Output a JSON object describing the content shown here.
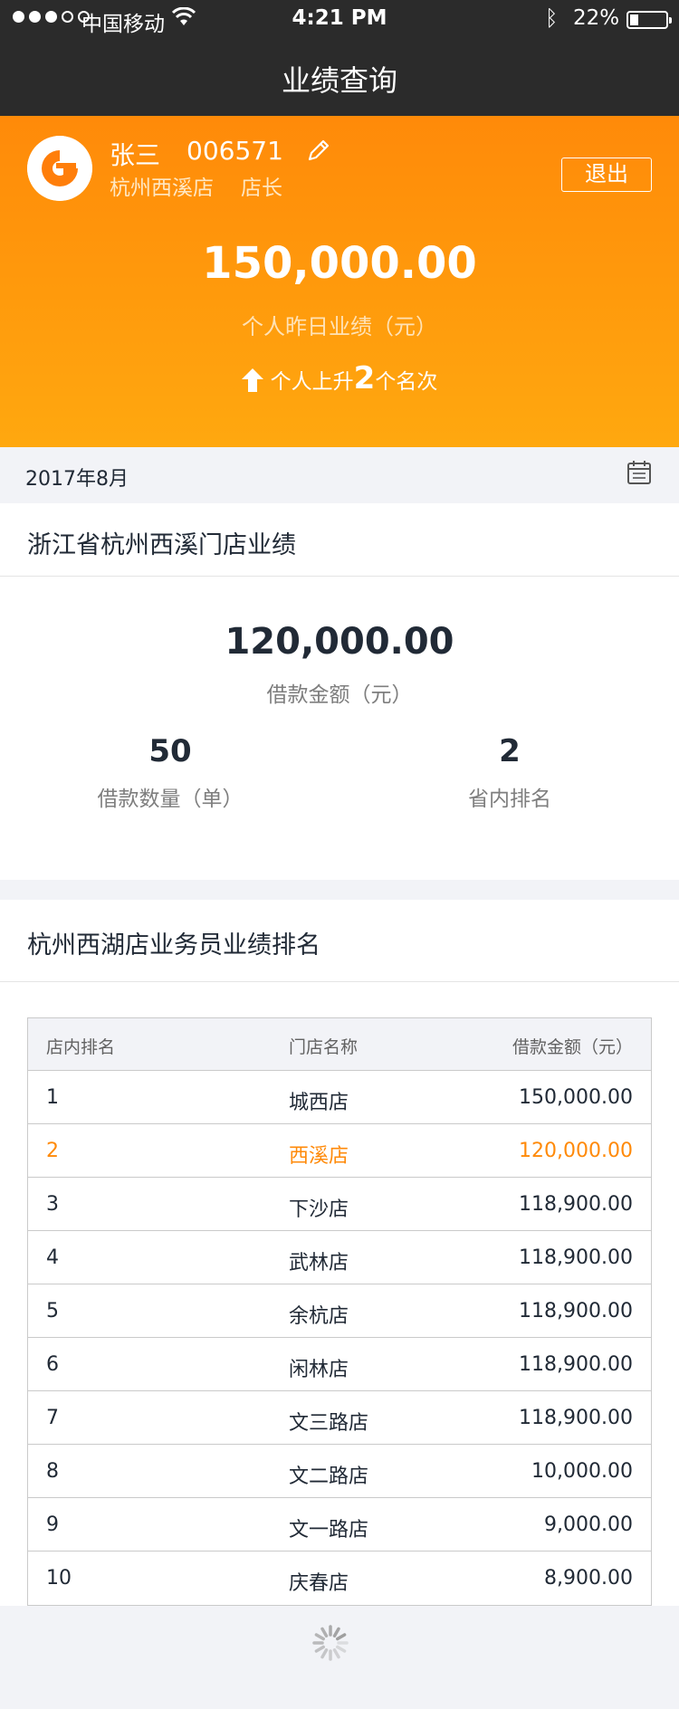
{
  "status_bar": {
    "carrier": "中国移动",
    "time": "4:21 PM",
    "battery_percent": "22%",
    "battery_level": 0.22
  },
  "nav": {
    "title": "业绩查询"
  },
  "profile": {
    "name": "张三",
    "employee_id": "006571",
    "store": "杭州西溪店",
    "role": "店长",
    "logout_label": "退出"
  },
  "summary": {
    "amount": "150,000.00",
    "amount_label": "个人昨日业绩（元）",
    "rank_prefix": "个人上升",
    "rank_change": "2",
    "rank_suffix": "个名次"
  },
  "date_bar": {
    "month": "2017年8月",
    "icon": "calendar-icon"
  },
  "store_panel": {
    "title": "浙江省杭州西溪门店业绩",
    "loan_amount": "120,000.00",
    "loan_amount_label": "借款金额（元）",
    "loan_count": "50",
    "loan_count_label": "借款数量（单）",
    "province_rank": "2",
    "province_rank_label": "省内排名"
  },
  "ranking": {
    "title": "杭州西湖店业务员业绩排名",
    "headers": [
      "店内排名",
      "门店名称",
      "借款金额（元）"
    ],
    "rows": [
      {
        "rank": "1",
        "store": "城西店",
        "amount": "150,000.00"
      },
      {
        "rank": "2",
        "store": "西溪店",
        "amount": "120,000.00",
        "highlight": true
      },
      {
        "rank": "3",
        "store": "下沙店",
        "amount": "118,900.00"
      },
      {
        "rank": "4",
        "store": "武林店",
        "amount": "118,900.00"
      },
      {
        "rank": "5",
        "store": "余杭店",
        "amount": "118,900.00"
      },
      {
        "rank": "6",
        "store": "闲林店",
        "amount": "118,900.00"
      },
      {
        "rank": "7",
        "store": "文三路店",
        "amount": "118,900.00"
      },
      {
        "rank": "8",
        "store": "文二路店",
        "amount": "10,000.00"
      },
      {
        "rank": "9",
        "store": "文一路店",
        "amount": "9,000.00"
      },
      {
        "rank": "10",
        "store": "庆春店",
        "amount": "8,900.00"
      }
    ]
  },
  "colors": {
    "accent": "#ff8a09",
    "text_primary": "#212a36",
    "text_secondary": "#7e7e7e",
    "header_text": "#626262",
    "divider": "#e4e4e4",
    "table_border": "#cacaca",
    "background": "#f2f3f7",
    "panel": "#ffffff"
  }
}
